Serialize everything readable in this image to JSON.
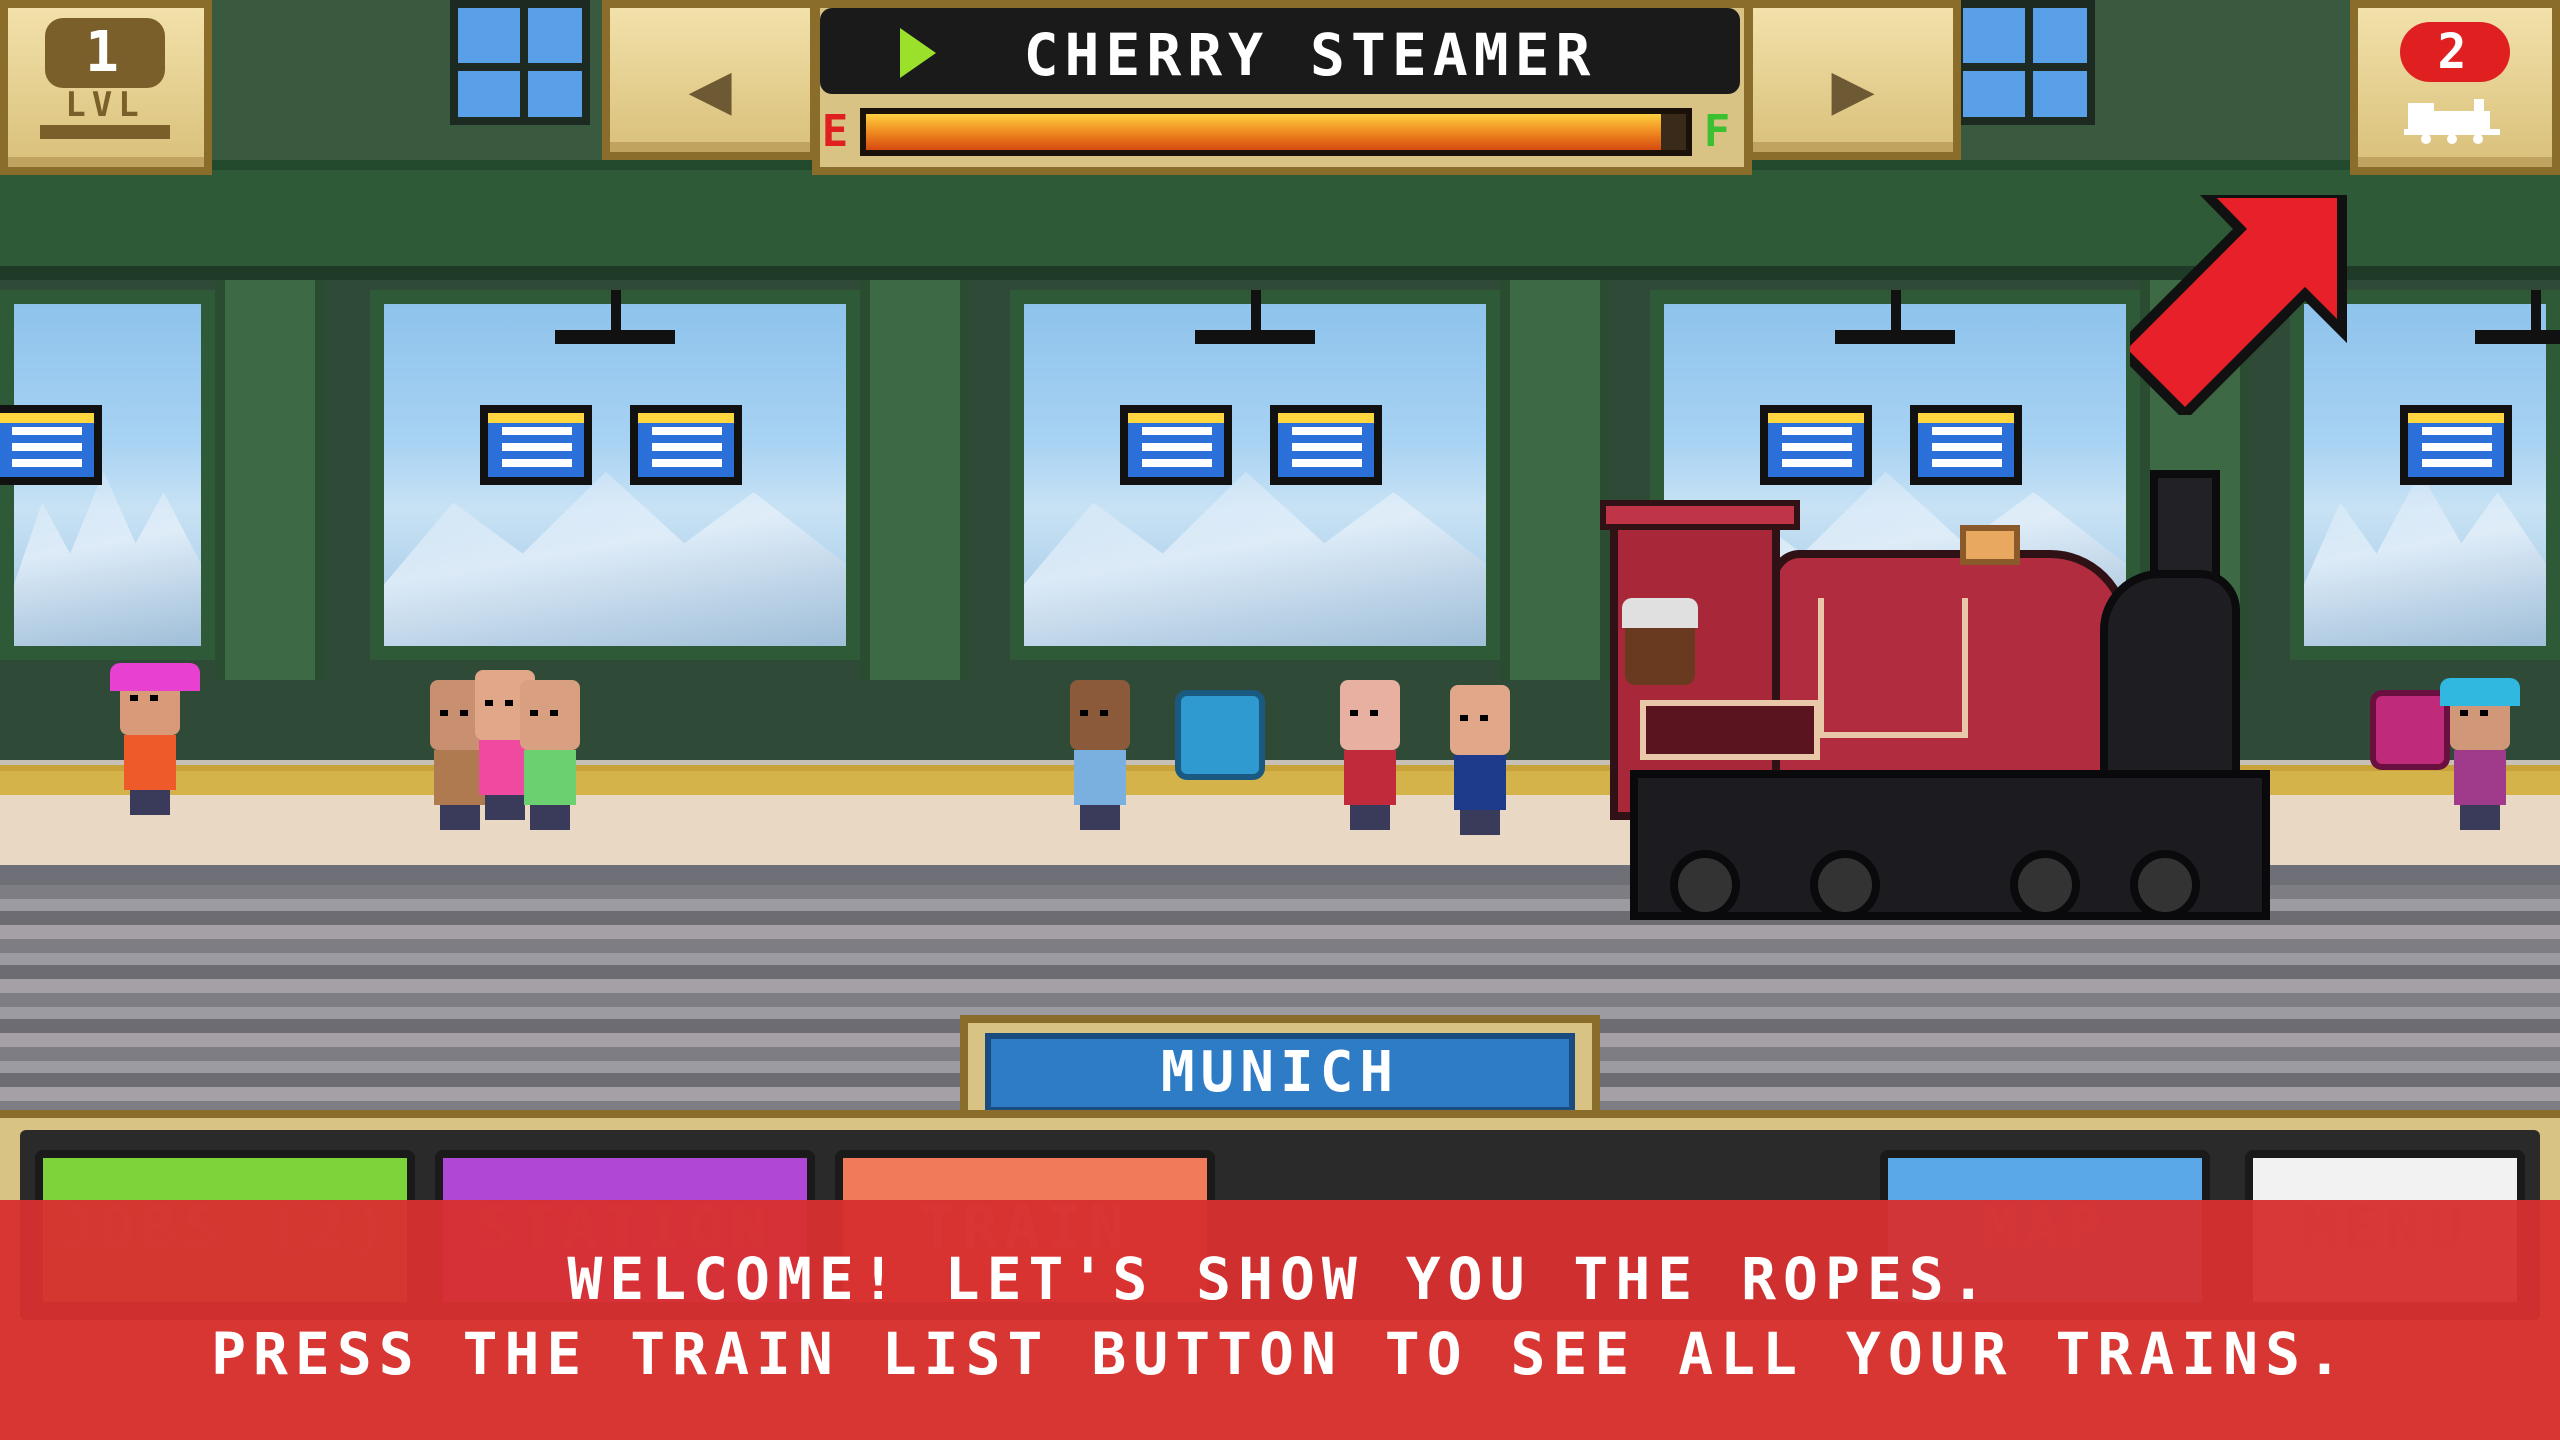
{
  "hud": {
    "level_value": "1",
    "level_label": "LVL",
    "train_name": "CHERRY STEAMER",
    "fuel_empty_label": "E",
    "fuel_full_label": "F",
    "fuel_level_fraction": 0.97,
    "prev_arrow": "◀",
    "next_arrow": "▶",
    "train_count": "2",
    "train_list_icon": "locomotive-icon"
  },
  "station": {
    "name": "MUNICH"
  },
  "bottom_nav": {
    "jobs_label": "JOBS (2)",
    "station_label": "STATION",
    "train_label": "TRAIN",
    "map_label": "MAP",
    "menu_label": "MENU"
  },
  "tutorial": {
    "line1": "WELCOME! LET'S SHOW YOU THE ROPES.",
    "line2": "PRESS THE TRAIN LIST BUTTON TO SEE ALL YOUR TRAINS."
  },
  "colors": {
    "tutorial_overlay": "#d63030",
    "station_label_bg": "#2e7bc6",
    "train_body": "#b02c3e",
    "hud_gold": "#d8c384"
  }
}
